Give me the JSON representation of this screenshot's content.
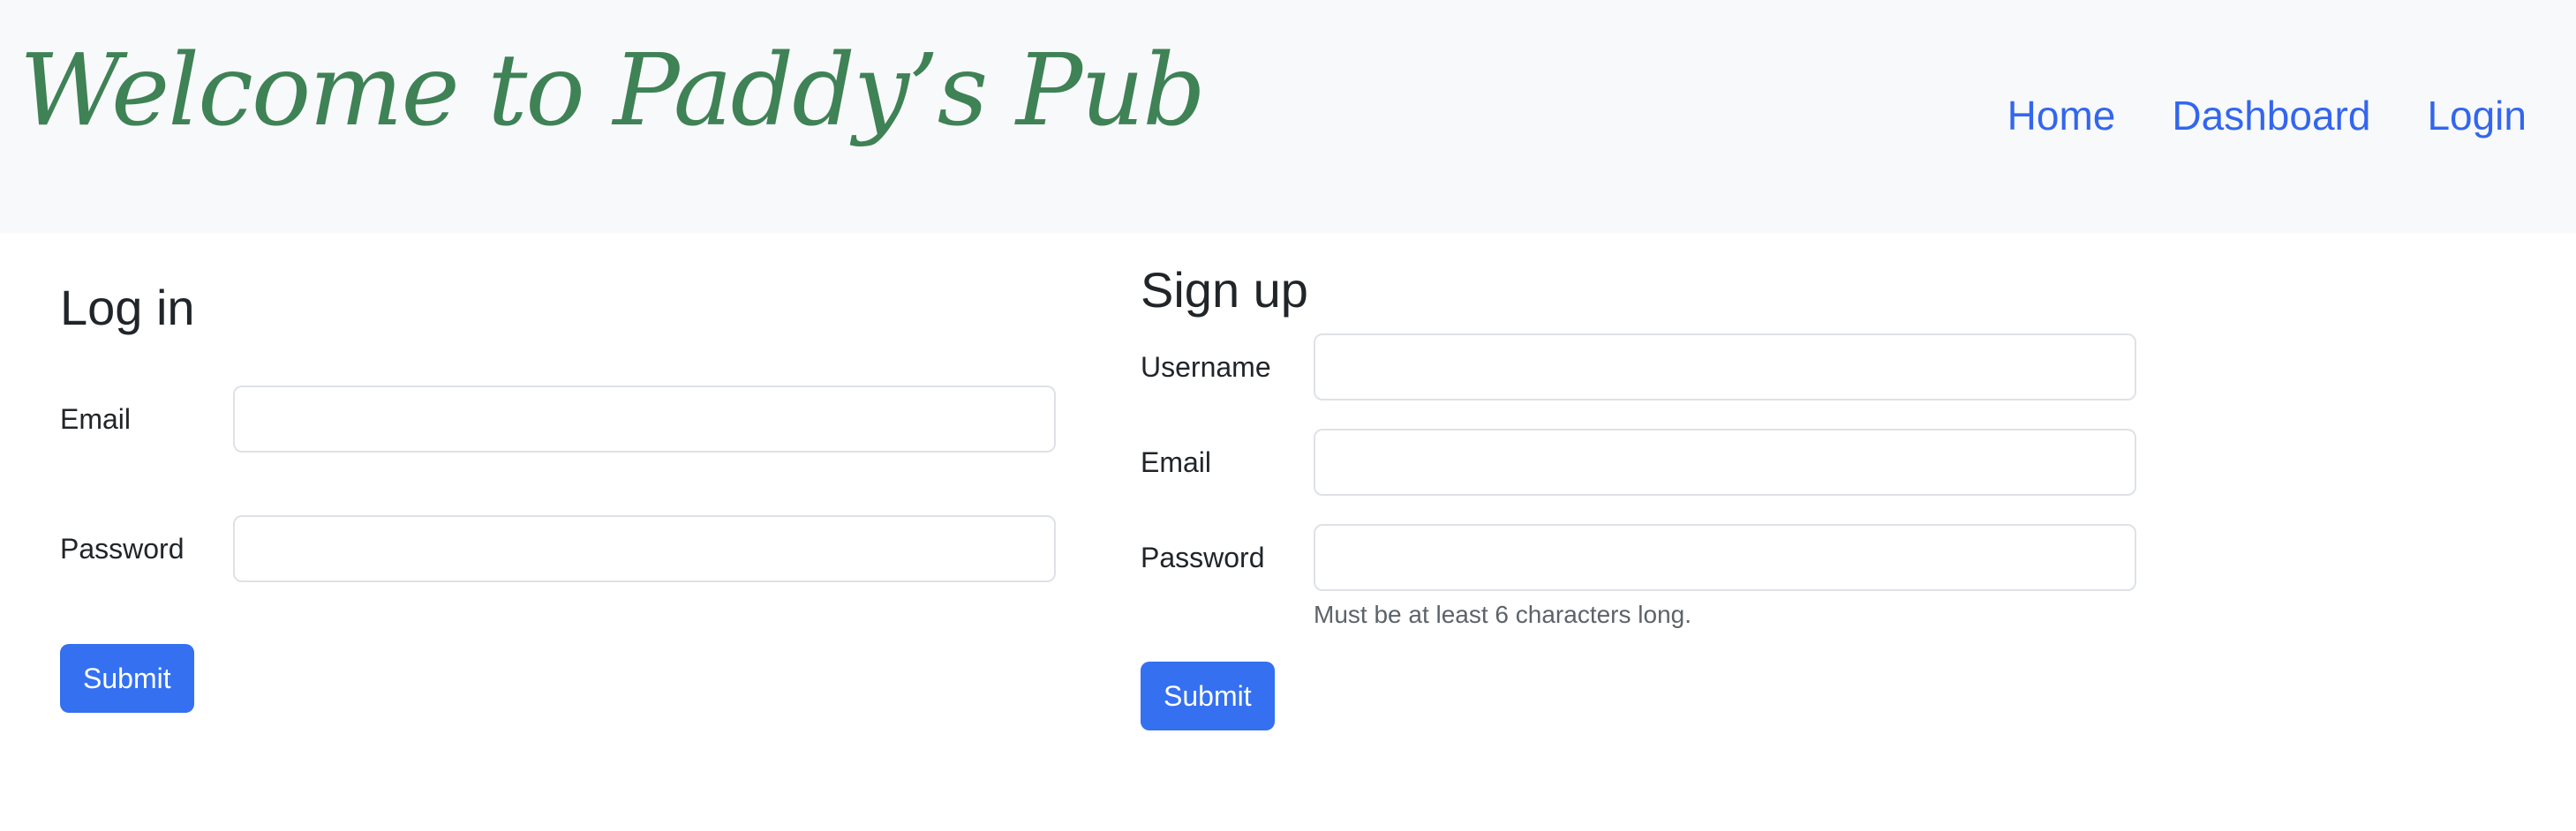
{
  "header": {
    "brand_title": "Welcome to Paddy’s Pub",
    "nav": [
      {
        "label": "Home"
      },
      {
        "label": "Dashboard"
      },
      {
        "label": "Login"
      }
    ]
  },
  "login": {
    "title": "Log in",
    "email_label": "Email",
    "email_value": "",
    "password_label": "Password",
    "password_value": "",
    "submit_label": "Submit"
  },
  "signup": {
    "title": "Sign up",
    "username_label": "Username",
    "username_value": "",
    "email_label": "Email",
    "email_value": "",
    "password_label": "Password",
    "password_value": "",
    "password_help": "Must be at least 6 characters long.",
    "submit_label": "Submit"
  },
  "colors": {
    "brand_green": "#3e8256",
    "link_blue": "#3366ee",
    "button_blue": "#3470f0",
    "navbar_bg": "#f8f9fa"
  }
}
